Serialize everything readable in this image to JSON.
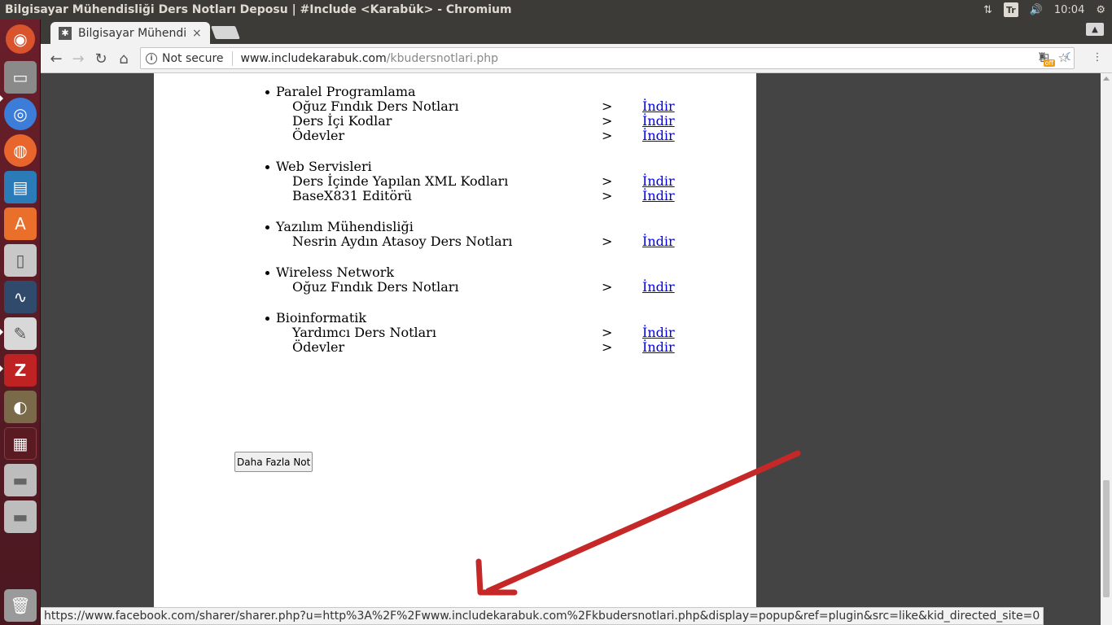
{
  "panel": {
    "window_title": "Bilgisayar Mühendisliği Ders Notları Deposu | #Include <Karabük> - Chromium",
    "keyboard_layout": "Tr",
    "clock": "10:04"
  },
  "launcher": {
    "items": [
      "ubuntu-dash-icon",
      "files-icon",
      "chromium-icon",
      "firefox-icon",
      "writer-icon",
      "software-center-icon",
      "mouse-settings-icon",
      "system-monitor-icon",
      "text-editor-icon",
      "filezilla-icon",
      "gimp-icon",
      "workspace-switcher-icon",
      "drive-icon",
      "drive-icon",
      "trash-icon"
    ]
  },
  "browser": {
    "tab_title": "Bilgisayar Mühendi",
    "tab_close": "×",
    "security_label": "Not secure",
    "url_host": "www.includekarabuk.com",
    "url_path": "/kbudersnotlari.php",
    "off_badge": "off"
  },
  "content": {
    "sections": [
      {
        "title": "Paralel Programlama",
        "rows": [
          {
            "name": "Oğuz Fındık Ders Notları",
            "arrow": ">",
            "link": "İndir"
          },
          {
            "name": "Ders İçi Kodlar",
            "arrow": ">",
            "link": "İndir"
          },
          {
            "name": "Ödevler",
            "arrow": ">",
            "link": "İndir"
          }
        ]
      },
      {
        "title": "Web Servisleri",
        "rows": [
          {
            "name": "Ders İçinde Yapılan XML Kodları",
            "arrow": ">",
            "link": "İndir"
          },
          {
            "name": "BaseX831 Editörü",
            "arrow": ">",
            "link": "İndir"
          }
        ]
      },
      {
        "title": "Yazılım Mühendisliği",
        "rows": [
          {
            "name": "Nesrin Aydın Atasoy Ders Notları",
            "arrow": ">",
            "link": "İndir"
          }
        ]
      },
      {
        "title": "Wireless Network",
        "rows": [
          {
            "name": "Oğuz Fındık Ders Notları",
            "arrow": ">",
            "link": "İndir"
          }
        ]
      },
      {
        "title": "Bioinformatik",
        "rows": [
          {
            "name": "Yardımcı Ders Notları",
            "arrow": ">",
            "link": "İndir"
          },
          {
            "name": "Ödevler",
            "arrow": ">",
            "link": "İndir"
          }
        ]
      }
    ],
    "more_button": "Daha Fazla Not"
  },
  "status_url": "https://www.facebook.com/sharer/sharer.php?u=http%3A%2F%2Fwww.includekarabuk.com%2Fkbudersnotlari.php&display=popup&ref=plugin&src=like&kid_directed_site=0",
  "colors": {
    "link": "#0000ee",
    "annotation_arrow": "#c62828",
    "launcher": "#6a1f2a"
  }
}
